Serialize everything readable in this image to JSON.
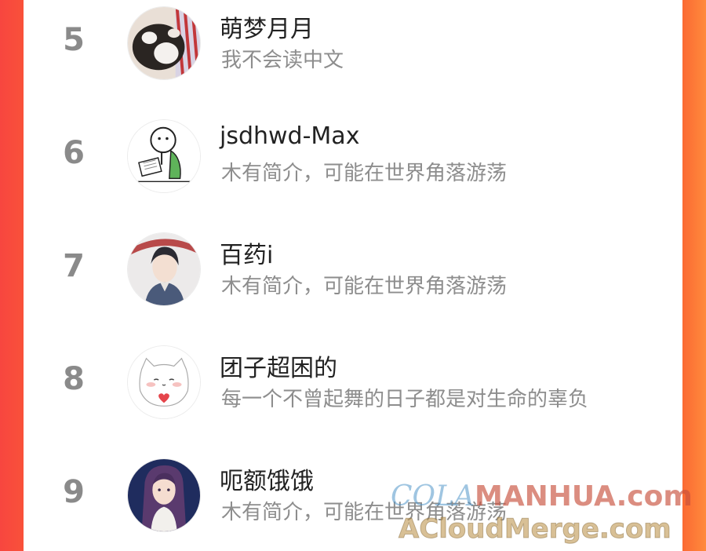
{
  "ranking": [
    {
      "rank": "5",
      "name": "萌梦月月",
      "bio": "我不会读中文",
      "avatar": "cat-photo-avatar"
    },
    {
      "rank": "6",
      "name": "jsdhwd-Max",
      "bio": "木有简介，可能在世界角落游荡",
      "avatar": "cartoon-reading-avatar"
    },
    {
      "rank": "7",
      "name": "百药i",
      "bio": "木有简介，可能在世界角落游荡",
      "avatar": "anime-man-umbrella-avatar"
    },
    {
      "rank": "8",
      "name": "团子超困的",
      "bio": "每一个不曾起舞的日子都是对生命的辜负",
      "avatar": "white-cat-heart-avatar"
    },
    {
      "rank": "9",
      "name": "呃额饿饿",
      "bio": "木有简介，可能在世界角落游荡",
      "avatar": "anime-girl-avatar"
    }
  ],
  "watermark": {
    "line1_part1": "COLA",
    "line1_part2": "MANHUA.com",
    "line2": "ACloudMerge.com"
  },
  "colors": {
    "left_edge": "#f7463f",
    "right_edge": "#ff8a3c",
    "rank_color": "#8a8a8a",
    "bio_color": "#8d8d8d"
  }
}
